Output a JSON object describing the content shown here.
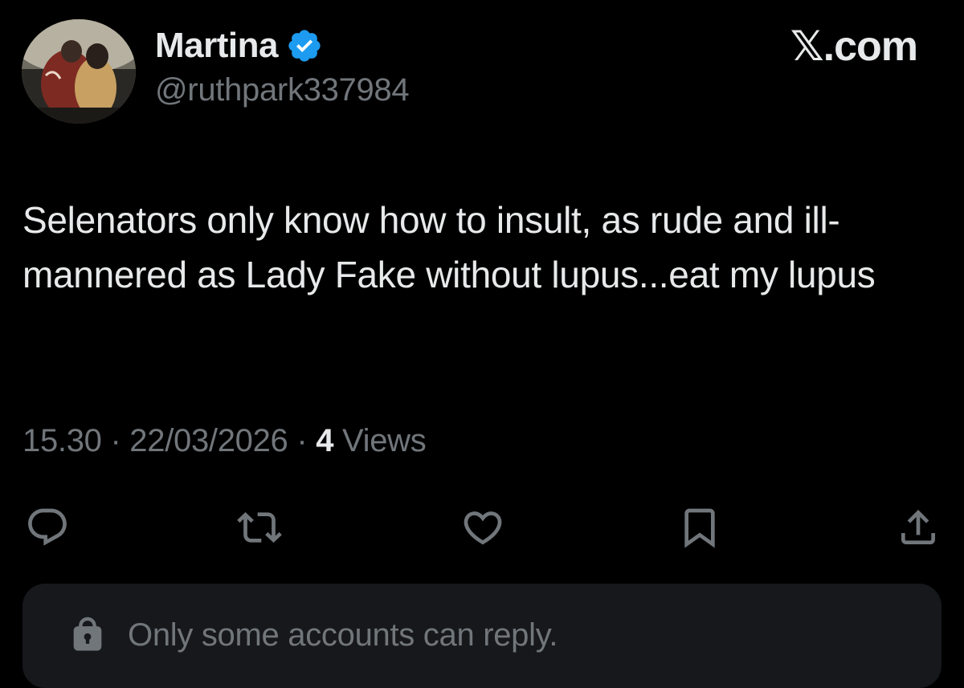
{
  "user": {
    "display_name": "Martina",
    "handle": "@ruthpark337984",
    "verified": true,
    "avatar_icon": "avatar-photo"
  },
  "brand": {
    "label": "𝕏.com"
  },
  "tweet": {
    "text": "Selenators only know how to insult, as rude and ill-mannered as Lady Fake without lupus...eat my lupus"
  },
  "meta": {
    "time": "15.30",
    "separator": "·",
    "date": "22/03/2026",
    "views_count": "4",
    "views_label": "Views"
  },
  "actions": [
    {
      "name": "reply",
      "icon": "speech-bubble-icon"
    },
    {
      "name": "repost",
      "icon": "repost-arrows-icon"
    },
    {
      "name": "like",
      "icon": "heart-icon"
    },
    {
      "name": "bookmark",
      "icon": "bookmark-icon"
    },
    {
      "name": "share",
      "icon": "share-upload-icon"
    }
  ],
  "reply_restriction": {
    "icon": "lock-icon",
    "text": "Only some accounts can reply."
  },
  "colors": {
    "background": "#000000",
    "primary_text": "#e7e9ea",
    "secondary_text": "#71767b",
    "verified_blue": "#1d9bf0",
    "reply_box": "#16181c"
  }
}
